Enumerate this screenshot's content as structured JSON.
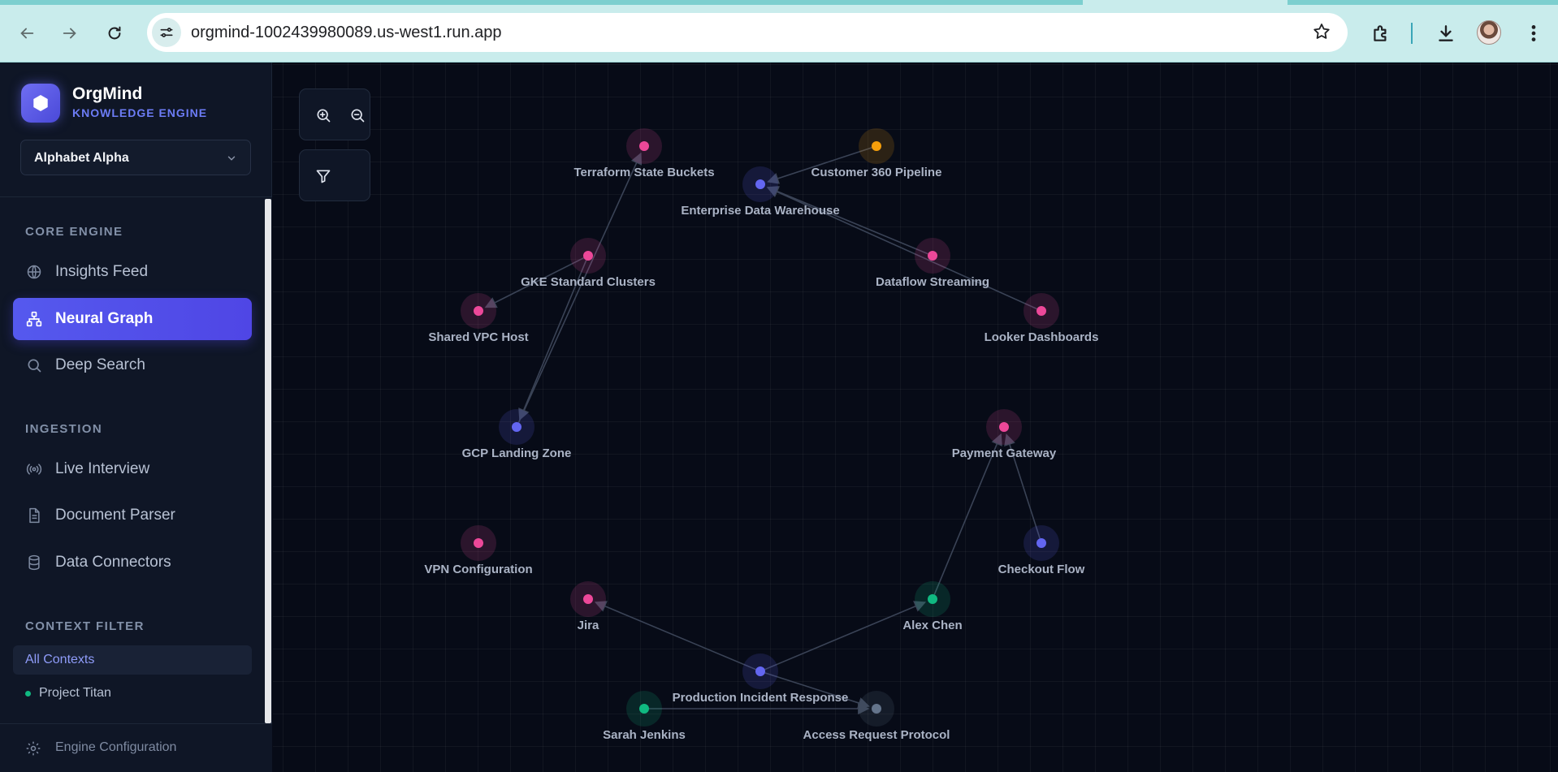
{
  "browser": {
    "url": "orgmind-1002439980089.us-west1.run.app"
  },
  "sidebar": {
    "brand_name": "OrgMind",
    "brand_subtitle": "KNOWLEDGE ENGINE",
    "org_select": "Alphabet Alpha",
    "sections": {
      "core_engine": "CORE ENGINE",
      "ingestion": "INGESTION",
      "context_filter": "CONTEXT FILTER"
    },
    "items": {
      "insights_feed": "Insights Feed",
      "neural_graph": "Neural Graph",
      "deep_search": "Deep Search",
      "live_interview": "Live Interview",
      "document_parser": "Document Parser",
      "data_connectors": "Data Connectors"
    },
    "contexts": {
      "all": "All Contexts",
      "project_titan": "Project Titan"
    },
    "footer": "Engine Configuration"
  },
  "graph": {
    "nodes": [
      {
        "id": "terraform",
        "label": "Terraform State Buckets",
        "color": "#ec4899"
      },
      {
        "id": "customer360",
        "label": "Customer 360 Pipeline",
        "color": "#f59e0b"
      },
      {
        "id": "edw",
        "label": "Enterprise Data Warehouse",
        "color": "#6366f1"
      },
      {
        "id": "gke",
        "label": "GKE Standard Clusters",
        "color": "#ec4899"
      },
      {
        "id": "dataflow",
        "label": "Dataflow Streaming",
        "color": "#ec4899"
      },
      {
        "id": "vpc",
        "label": "Shared VPC Host",
        "color": "#ec4899"
      },
      {
        "id": "looker",
        "label": "Looker Dashboards",
        "color": "#ec4899"
      },
      {
        "id": "landing",
        "label": "GCP Landing Zone",
        "color": "#6366f1"
      },
      {
        "id": "payment",
        "label": "Payment Gateway",
        "color": "#ec4899"
      },
      {
        "id": "vpn",
        "label": "VPN Configuration",
        "color": "#ec4899"
      },
      {
        "id": "checkout",
        "label": "Checkout Flow",
        "color": "#6366f1"
      },
      {
        "id": "jira",
        "label": "Jira",
        "color": "#ec4899"
      },
      {
        "id": "alex",
        "label": "Alex Chen",
        "color": "#10b981"
      },
      {
        "id": "incident",
        "label": "Production Incident Response",
        "color": "#6366f1"
      },
      {
        "id": "sarah",
        "label": "Sarah Jenkins",
        "color": "#10b981"
      },
      {
        "id": "access",
        "label": "Access Request Protocol",
        "color": "#64748b"
      }
    ],
    "edges": [
      {
        "from": "customer360",
        "to": "edw"
      },
      {
        "from": "dataflow",
        "to": "edw"
      },
      {
        "from": "looker",
        "to": "edw"
      },
      {
        "from": "landing",
        "to": "terraform"
      },
      {
        "from": "gke",
        "to": "vpc"
      },
      {
        "from": "gke",
        "to": "landing"
      },
      {
        "from": "alex",
        "to": "payment"
      },
      {
        "from": "checkout",
        "to": "payment"
      },
      {
        "from": "incident",
        "to": "jira"
      },
      {
        "from": "incident",
        "to": "alex"
      },
      {
        "from": "incident",
        "to": "access"
      },
      {
        "from": "sarah",
        "to": "access"
      }
    ]
  }
}
